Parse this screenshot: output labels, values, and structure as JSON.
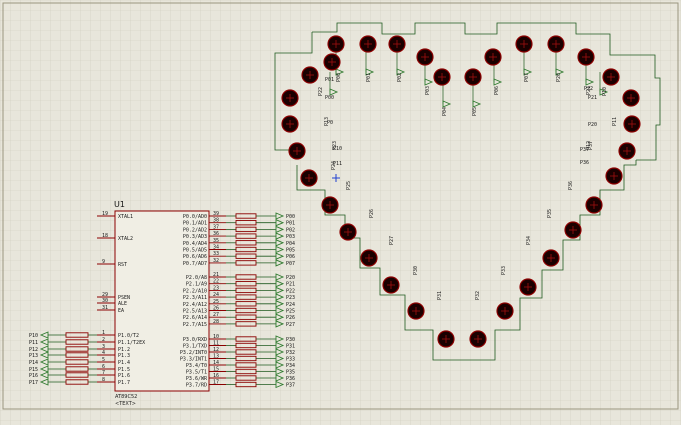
{
  "schematic": {
    "ic": {
      "ref": "U1",
      "part": "AT89C52",
      "text_placeholder": "<TEXT>",
      "left_pins": [
        {
          "num": "19",
          "name": "XTAL1"
        },
        {
          "num": "18",
          "name": "XTAL2"
        },
        {
          "num": "9",
          "name": "RST"
        },
        {
          "num": "29",
          "name": "PSEN"
        },
        {
          "num": "30",
          "name": "ALE"
        },
        {
          "num": "31",
          "name": "EA"
        },
        {
          "num": "1",
          "name": "P1.0/T2"
        },
        {
          "num": "2",
          "name": "P1.1/T2EX"
        },
        {
          "num": "3",
          "name": "P1.2"
        },
        {
          "num": "4",
          "name": "P1.3"
        },
        {
          "num": "5",
          "name": "P1.4"
        },
        {
          "num": "6",
          "name": "P1.5"
        },
        {
          "num": "7",
          "name": "P1.6"
        },
        {
          "num": "8",
          "name": "P1.7"
        }
      ],
      "right_pins": [
        {
          "num": "39",
          "name": "P0.0/AD0"
        },
        {
          "num": "38",
          "name": "P0.1/AD1"
        },
        {
          "num": "37",
          "name": "P0.2/AD2"
        },
        {
          "num": "36",
          "name": "P0.3/AD3"
        },
        {
          "num": "35",
          "name": "P0.4/AD4"
        },
        {
          "num": "34",
          "name": "P0.5/AD5"
        },
        {
          "num": "33",
          "name": "P0.6/AD6"
        },
        {
          "num": "32",
          "name": "P0.7/AD7"
        },
        {
          "num": "21",
          "name": "P2.0/A8"
        },
        {
          "num": "22",
          "name": "P2.1/A9"
        },
        {
          "num": "23",
          "name": "P2.2/A10"
        },
        {
          "num": "24",
          "name": "P2.3/A11"
        },
        {
          "num": "25",
          "name": "P2.4/A12"
        },
        {
          "num": "26",
          "name": "P2.5/A13"
        },
        {
          "num": "27",
          "name": "P2.6/A14"
        },
        {
          "num": "28",
          "name": "P2.7/A15"
        },
        {
          "num": "10",
          "name": "P3.0/RXD"
        },
        {
          "num": "11",
          "name": "P3.1/TXD"
        },
        {
          "num": "12",
          "name": "P3.2/INT0"
        },
        {
          "num": "13",
          "name": "P3.3/INT1"
        },
        {
          "num": "14",
          "name": "P3.4/T0"
        },
        {
          "num": "15",
          "name": "P3.5/T1"
        },
        {
          "num": "16",
          "name": "P3.6/WR"
        },
        {
          "num": "17",
          "name": "P3.7/RD"
        }
      ]
    },
    "right_net_labels": [
      "P00",
      "P01",
      "P02",
      "P03",
      "P04",
      "P05",
      "P06",
      "P07",
      "P20",
      "P21",
      "P22",
      "P23",
      "P24",
      "P25",
      "P26",
      "P27",
      "P30",
      "P31",
      "P32",
      "P33",
      "P34",
      "P35",
      "P36",
      "P37"
    ],
    "left_net_labels": [
      "P10",
      "P11",
      "P12",
      "P13",
      "P14",
      "P15",
      "P16",
      "P17"
    ],
    "heart_labels": [
      "P00",
      "P01",
      "P02",
      "P03",
      "P04",
      "P05",
      "P06",
      "P07",
      "P20",
      "P21",
      "P22",
      "P23",
      "P24",
      "P25",
      "P26",
      "P27",
      "P30",
      "P31",
      "P32",
      "P33",
      "P34",
      "P35",
      "P36",
      "P37",
      "P10",
      "P11",
      "P12",
      "P13",
      "P14",
      "P15",
      "P16",
      "P17"
    ],
    "colors": {
      "background": "#e8e6db",
      "grid": "#cfccbd",
      "wire": "#1f5a1f",
      "component": "#8b0000",
      "led_fill": "#1a0000",
      "terminal": "#2e7a2e"
    }
  }
}
